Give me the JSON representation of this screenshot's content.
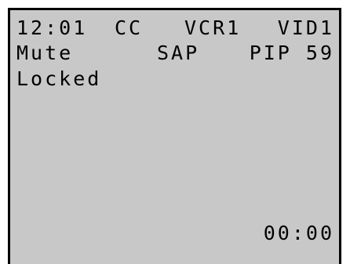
{
  "osd": {
    "clock": "12:01",
    "cc": "CC",
    "source": "VCR1",
    "video_input": "VID1",
    "mute": "Mute",
    "sap": "SAP",
    "pip": "PIP 59",
    "locked": "Locked",
    "timer": "00:00"
  },
  "colors": {
    "screen_background": "#c8c8c8",
    "text": "#000000",
    "border": "#000000"
  }
}
